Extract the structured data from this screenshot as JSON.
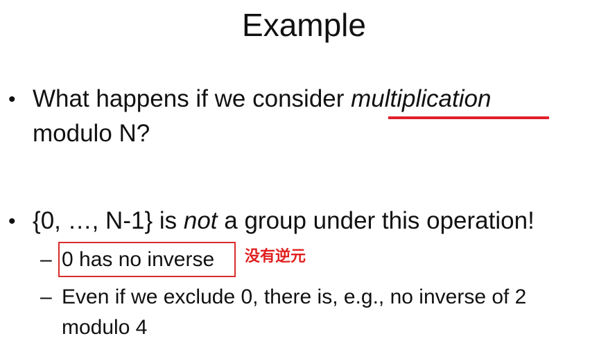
{
  "title": "Example",
  "bullets": [
    {
      "line1_pre": "What happens if we consider ",
      "line1_em": "multiplication",
      "line2": "modulo N?"
    },
    {
      "pre": "{0, …, N-1} is ",
      "em": "not",
      "post": " a group under this operation!"
    }
  ],
  "sub_items": [
    {
      "dash": "–",
      "text": "0 has no inverse"
    },
    {
      "dash": "–",
      "line1": "Even if we exclude 0, there is, e.g., no inverse of 2",
      "line2": "modulo 4"
    }
  ],
  "annotation": "没有逆元",
  "colors": {
    "annotation": "#e02020",
    "underline": "#e0202a",
    "box": "#d92b2b"
  }
}
